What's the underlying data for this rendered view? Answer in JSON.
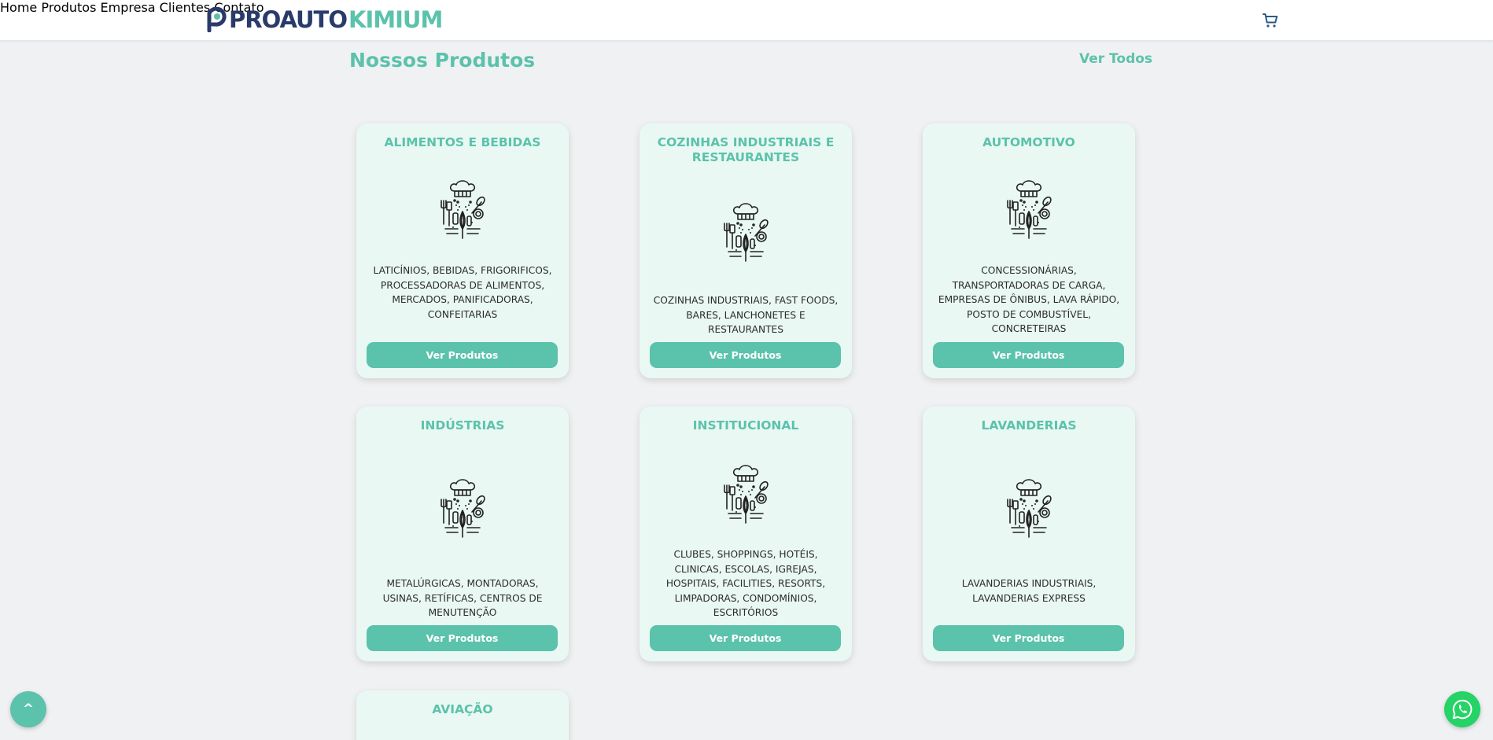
{
  "brand": {
    "word1": "PROAUTO",
    "word2": "KIMIUM",
    "colors": {
      "navy": "#2a3a6b",
      "teal": "#5bc2ab"
    }
  },
  "nav": {
    "items": [
      "Home",
      "Produtos",
      "Empresa",
      "Clientes",
      "Contato"
    ],
    "cart_icon": "cart-icon"
  },
  "section": {
    "title": "Nossos Produtos",
    "see_all": "Ver Todos"
  },
  "cards": [
    {
      "title": "ALIMENTOS E BEBIDAS",
      "description": "LATICÍNIOS, BEBIDAS, FRIGORIFICOS, PROCESSADORAS DE ALIMENTOS, MERCADOS, PANIFICADORAS, CONFEITARIAS",
      "button": "Ver Produtos",
      "icon": "kitchen-tools-icon"
    },
    {
      "title": "COZINHAS INDUSTRIAIS E RESTAURANTES",
      "description": "COZINHAS INDUSTRIAIS, FAST FOODS, BARES, LANCHONETES E RESTAURANTES",
      "button": "Ver Produtos",
      "icon": "kitchen-tools-icon"
    },
    {
      "title": "AUTOMOTIVO",
      "description": "CONCESSIONÁRIAS, TRANSPORTADORAS DE CARGA, EMPRESAS DE ÔNIBUS, LAVA RÁPIDO, POSTO DE COMBUSTÍVEL, CONCRETEIRAS",
      "button": "Ver Produtos",
      "icon": "kitchen-tools-icon"
    },
    {
      "title": "INDÚSTRIAS",
      "description": "METALÚRGICAS, MONTADORAS, USINAS, RETÍFICAS, CENTROS DE MENUTENÇÃO",
      "button": "Ver Produtos",
      "icon": "kitchen-tools-icon"
    },
    {
      "title": "INSTITUCIONAL",
      "description": "CLUBES, SHOPPINGS, HOTÉIS, CLINICAS, ESCOLAS, IGREJAS, HOSPITAIS, FACILITIES, RESORTS, LIMPADORAS, CONDOMÍNIOS, ESCRITÓRIOS",
      "button": "Ver Produtos",
      "icon": "kitchen-tools-icon"
    },
    {
      "title": "LAVANDERIAS",
      "description": "LAVANDERIAS INDUSTRIAIS, LAVANDERIAS EXPRESS",
      "button": "Ver Produtos",
      "icon": "kitchen-tools-icon"
    },
    {
      "title": "AVIAÇÃO"
    }
  ],
  "floating": {
    "back_to_top": "^",
    "whatsapp_icon": "whatsapp-icon"
  }
}
